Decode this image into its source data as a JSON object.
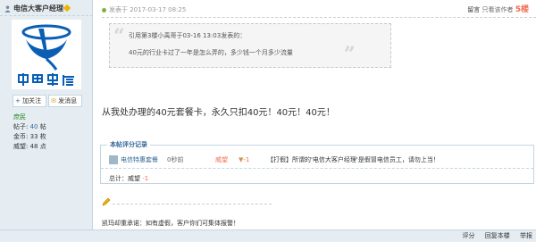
{
  "author": {
    "name": "电信大客户经理",
    "follow_label": "加关注",
    "message_label": "发消息",
    "rank": "庶民"
  },
  "stats": {
    "posts_label": "帖子:",
    "posts_value": "40",
    "posts_unit": "帖",
    "gold_label": "金币:",
    "gold_value": "33",
    "gold_unit": "枚",
    "rep_label": "威望:",
    "rep_value": "48",
    "rep_unit": "点"
  },
  "post": {
    "time": "发表于 2017-03-17 08:25",
    "only_op": "留言",
    "only_author": "只看该作者",
    "floor": "5楼",
    "quote_line1": "引用第3楼小禹哥于03-16 13:03发表的：",
    "quote_line2": "40元的行业卡过了一年是怎么弄的，多少钱一个月多少流量",
    "body": "从我处办理的40元套餐卡，永久只扣40元！40元！40元！"
  },
  "rating": {
    "title": "本帖评分记录",
    "user": "电信特惠套餐",
    "time": "0秒前",
    "field": "威望",
    "score": "-1",
    "reason": "【打假】所谓的'电信大客户经理'是假冒电信员工，请勿上当！",
    "total_label": "总计：威望",
    "total_score": "-1"
  },
  "signature": "凯玛却重承诺：如有虚假，客户你们可集体报警！",
  "footer": {
    "rate": "评分",
    "reply": "回复本楼",
    "report": "举报"
  },
  "colors": {
    "accent": "#336699",
    "brand_blue": "#0a5fb4",
    "score_red": "#f26c4f",
    "sidebar_bg": "#e5edf2"
  }
}
